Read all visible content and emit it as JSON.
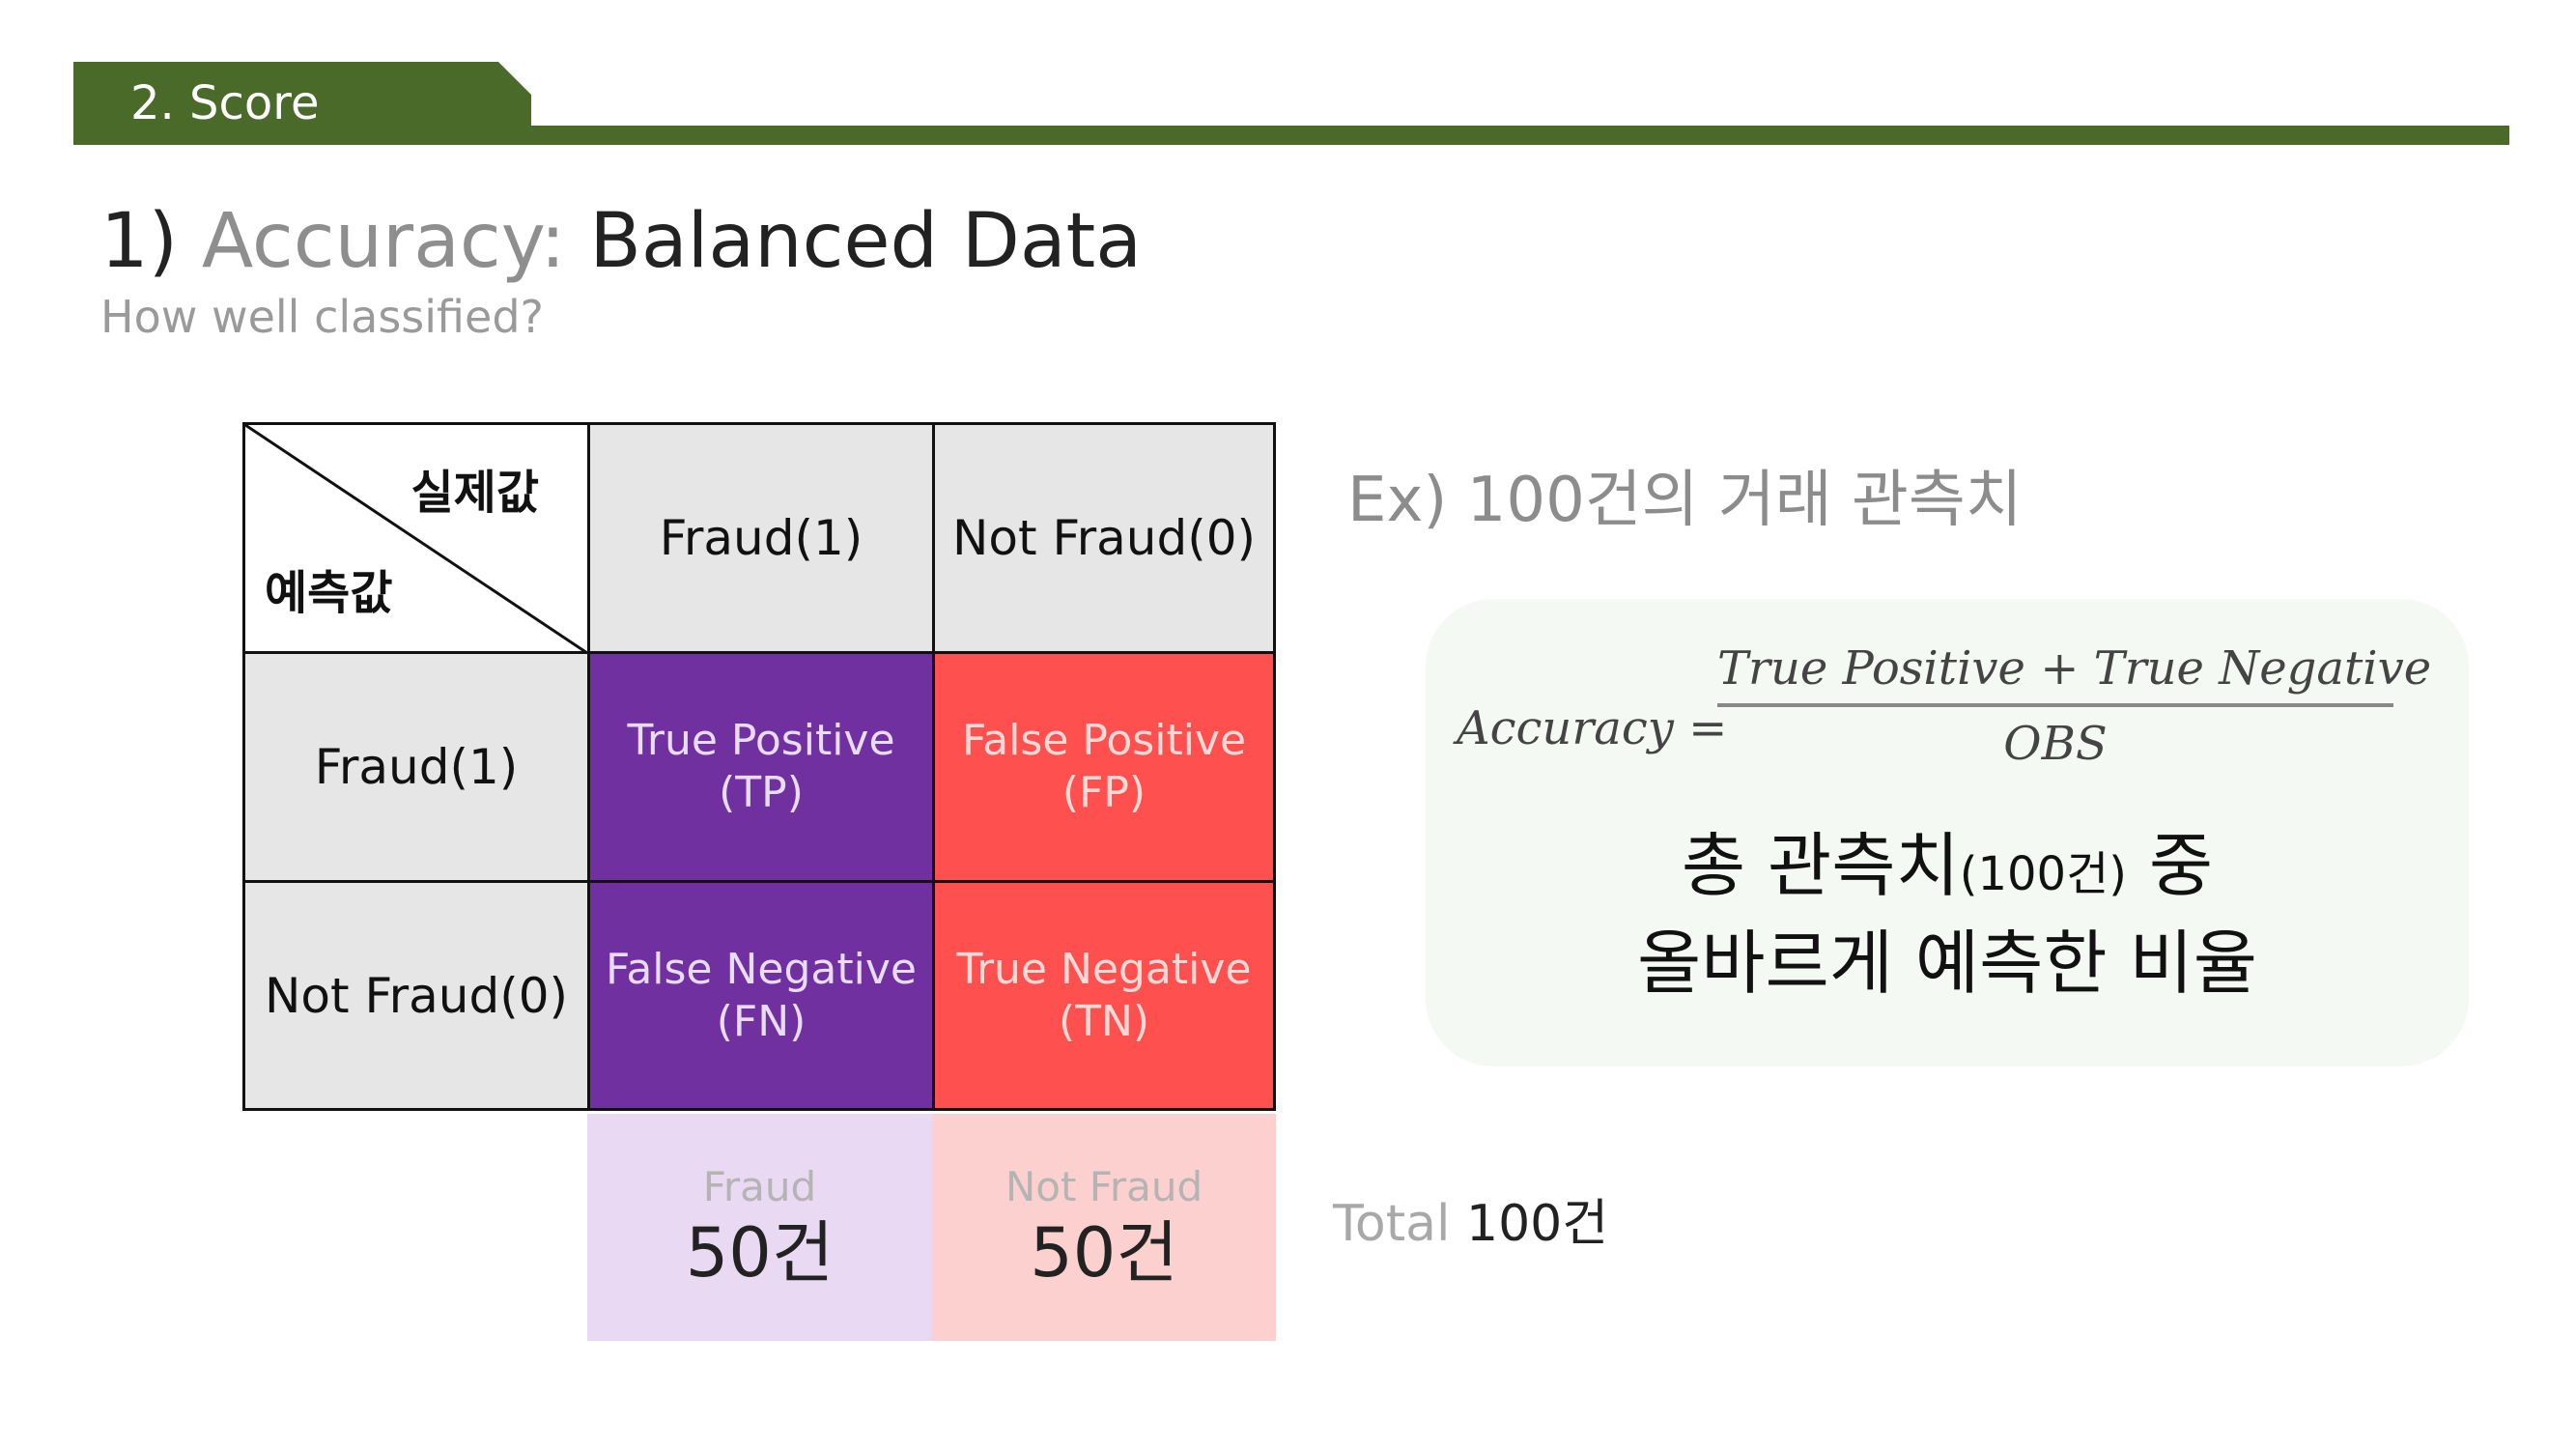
{
  "colors": {
    "accent": "#4a6a29",
    "purple": "#7030a0",
    "red": "#ff5050"
  },
  "header": {
    "section_label": "2. Score"
  },
  "title": {
    "number": "1)",
    "accent": "Accuracy:",
    "rest": "Balanced Data"
  },
  "subtitle": "How well classified?",
  "matrix": {
    "corner_actual": "실제값",
    "corner_predicted": "예측값",
    "columns": [
      "Fraud(1)",
      "Not Fraud(0)"
    ],
    "rows": [
      "Fraud(1)",
      "Not Fraud(0)"
    ],
    "cells": [
      [
        "True Positive",
        "(TP)"
      ],
      [
        "False Positive",
        "(FP)"
      ],
      [
        "False Negative",
        "(FN)"
      ],
      [
        "True Negative",
        "(TN)"
      ]
    ],
    "totals": [
      {
        "label": "Fraud",
        "value": "50건"
      },
      {
        "label": "Not Fraud",
        "value": "50건"
      }
    ]
  },
  "example": {
    "heading": "Ex) 100건의 거래 관측치",
    "formula": {
      "lhs": "Accuracy =",
      "numerator": "True Positive + True Negative",
      "denominator": "OBS"
    },
    "description_line1_a": "총 관측치",
    "description_line1_small": "(100건)",
    "description_line1_b": " 중",
    "description_line2": "올바르게 예측한 비율"
  },
  "total": {
    "label": "Total",
    "value": "100건"
  }
}
